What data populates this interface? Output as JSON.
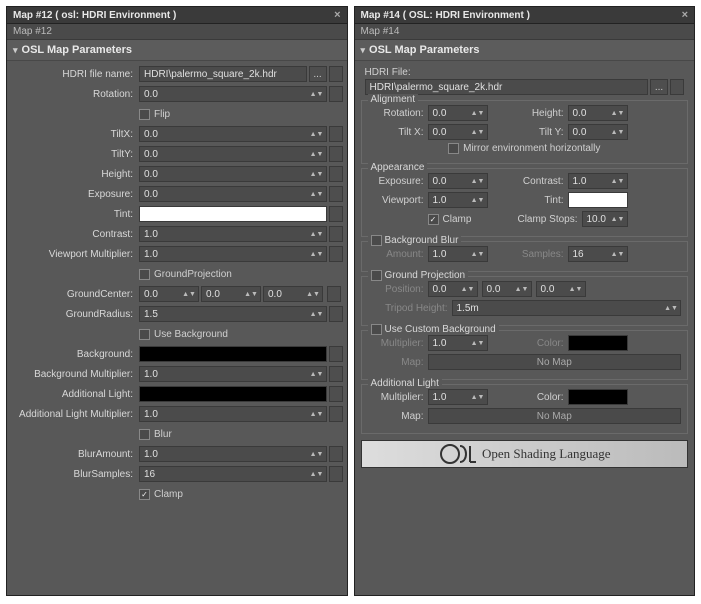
{
  "left": {
    "title": "Map #12  ( osl: HDRI Environment )",
    "sub": "Map #12",
    "rollup_title": "OSL Map Parameters",
    "labels": {
      "file": "HDRI file name:",
      "rotation": "Rotation:",
      "flip": "Flip",
      "tiltx": "TiltX:",
      "tilty": "TiltY:",
      "height": "Height:",
      "exposure": "Exposure:",
      "tint": "Tint:",
      "contrast": "Contrast:",
      "vmult": "Viewport Multiplier:",
      "gproj": "GroundProjection",
      "gcenter": "GroundCenter:",
      "gradius": "GroundRadius:",
      "usebg": "Use Background",
      "bg": "Background:",
      "bgmult": "Background Multiplier:",
      "alight": "Additional Light:",
      "almult": "Additional Light Multiplier:",
      "blur": "Blur",
      "blamt": "BlurAmount:",
      "blsamp": "BlurSamples:",
      "clamp": "Clamp"
    },
    "values": {
      "file": "HDRI\\palermo_square_2k.hdr",
      "rotation": "0.0",
      "tiltx": "0.0",
      "tilty": "0.0",
      "height": "0.0",
      "exposure": "0.0",
      "contrast": "1.0",
      "vmult": "1.0",
      "gcx": "0.0",
      "gcy": "0.0",
      "gcz": "0.0",
      "gradius": "1.5",
      "bgmult": "1.0",
      "almult": "1.0",
      "blamt": "1.0",
      "blsamp": "16"
    }
  },
  "right": {
    "title": "Map #14  ( OSL: HDRI Environment )",
    "sub": "Map #14",
    "rollup_title": "OSL Map Parameters",
    "hdri_label": "HDRI File:",
    "hdri_value": "HDRI\\palermo_square_2k.hdr",
    "alignment": {
      "legend": "Alignment",
      "rotation_l": "Rotation:",
      "rotation": "0.0",
      "height_l": "Height:",
      "height": "0.0",
      "tiltx_l": "Tilt X:",
      "tiltx": "0.0",
      "tilty_l": "Tilt Y:",
      "tilty": "0.0",
      "mirror": "Mirror environment horizontally"
    },
    "appearance": {
      "legend": "Appearance",
      "exposure_l": "Exposure:",
      "exposure": "0.0",
      "contrast_l": "Contrast:",
      "contrast": "1.0",
      "viewport_l": "Viewport:",
      "viewport": "1.0",
      "tint_l": "Tint:",
      "clamp": "Clamp",
      "clampstops_l": "Clamp Stops:",
      "clampstops": "10.0"
    },
    "bgblur": {
      "legend": "Background Blur",
      "amount_l": "Amount:",
      "amount": "1.0",
      "samples_l": "Samples:",
      "samples": "16"
    },
    "gproj": {
      "legend": "Ground Projection",
      "position_l": "Position:",
      "px": "0.0",
      "py": "0.0",
      "pz": "0.0",
      "tripod_l": "Tripod Height:",
      "tripod": "1.5m"
    },
    "custombg": {
      "legend": "Use Custom Background",
      "mult_l": "Multiplier:",
      "mult": "1.0",
      "color_l": "Color:",
      "map_l": "Map:",
      "map_v": "No Map"
    },
    "alight": {
      "legend": "Additional Light",
      "mult_l": "Multiplier:",
      "mult": "1.0",
      "color_l": "Color:",
      "map_l": "Map:",
      "map_v": "No Map"
    },
    "banner": "Open Shading Language"
  },
  "ellipsis": "..."
}
